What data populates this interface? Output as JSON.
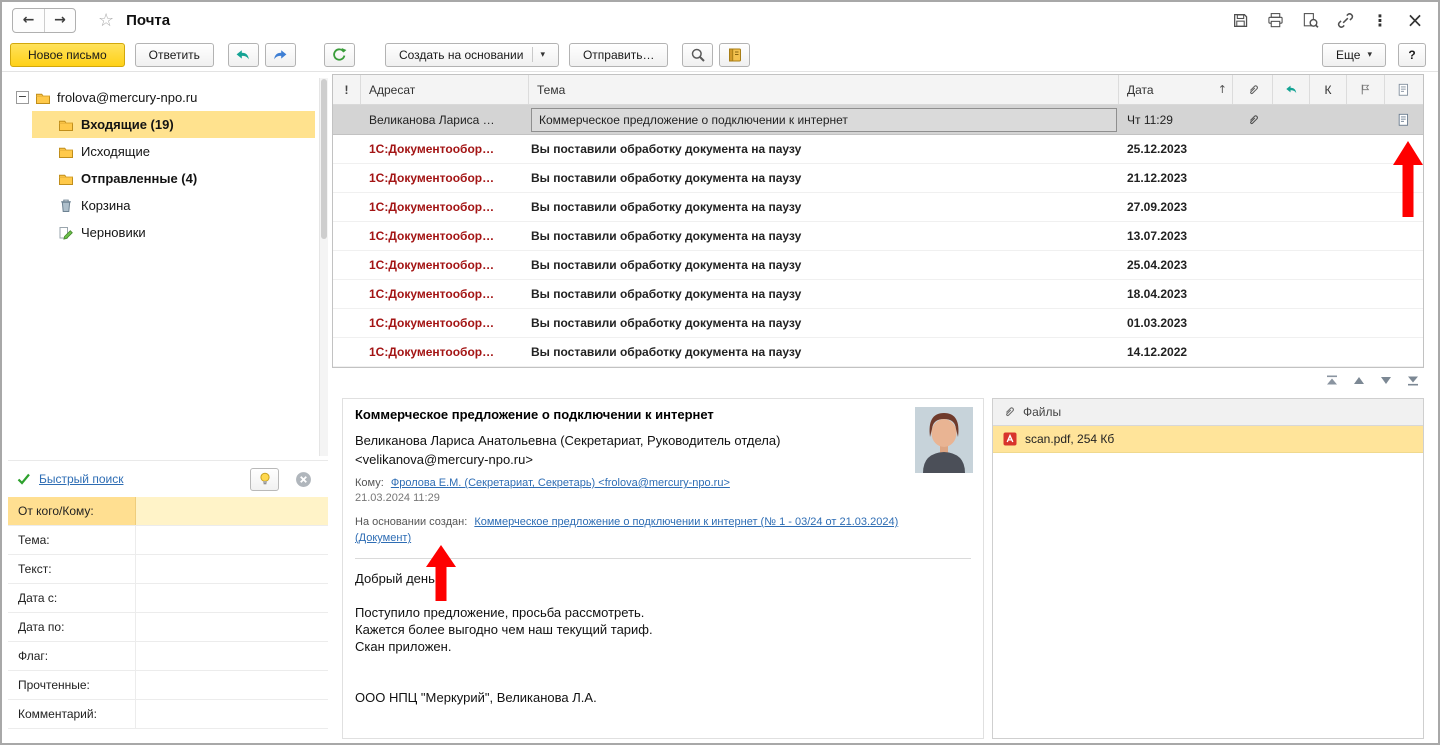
{
  "titlebar": {
    "title": "Почта"
  },
  "icons": {
    "back": "←",
    "forward": "→",
    "star": "☆",
    "kebab": "⋮",
    "close": "×",
    "caret_down": "▾",
    "sort_asc": "↑",
    "collapse": "−"
  },
  "toolbar": {
    "new_letter": "Новое письмо",
    "reply": "Ответить",
    "create_based_on": "Создать на основании",
    "send": "Отправить…",
    "more": "Еще",
    "help": "?"
  },
  "folders": {
    "account": "frolova@mercury-npo.ru",
    "items": [
      {
        "label": "Входящие (19)"
      },
      {
        "label": "Исходящие"
      },
      {
        "label": "Отправленные (4)"
      },
      {
        "label": "Корзина"
      },
      {
        "label": "Черновики"
      }
    ]
  },
  "quick_search": {
    "title": "Быстрый поиск",
    "fields": [
      {
        "label": "От кого/Кому:"
      },
      {
        "label": "Тема:"
      },
      {
        "label": "Текст:"
      },
      {
        "label": "Дата с:"
      },
      {
        "label": "Дата по:"
      },
      {
        "label": "Флаг:"
      },
      {
        "label": "Прочтенные:"
      },
      {
        "label": "Комментарий:"
      }
    ]
  },
  "mail_list": {
    "header": {
      "importance": "!",
      "addressee": "Адресат",
      "subject": "Тема",
      "date": "Дата",
      "k": "К"
    },
    "selected": {
      "addressee": "Великанова Лариса …",
      "subject": "Коммерческое предложение о подключении к интернет",
      "date": "Чт 11:29"
    },
    "rows": [
      {
        "addressee": "1С:Документообор…",
        "subject": "Вы поставили обработку документа на паузу",
        "date": "25.12.2023"
      },
      {
        "addressee": "1С:Документообор…",
        "subject": "Вы поставили обработку документа на паузу",
        "date": "21.12.2023"
      },
      {
        "addressee": "1С:Документообор…",
        "subject": "Вы поставили обработку документа на паузу",
        "date": "27.09.2023"
      },
      {
        "addressee": "1С:Документообор…",
        "subject": "Вы поставили обработку документа на паузу",
        "date": "13.07.2023"
      },
      {
        "addressee": "1С:Документообор…",
        "subject": "Вы поставили обработку документа на паузу",
        "date": "25.04.2023"
      },
      {
        "addressee": "1С:Документообор…",
        "subject": "Вы поставили обработку документа на паузу",
        "date": "18.04.2023"
      },
      {
        "addressee": "1С:Документообор…",
        "subject": "Вы поставили обработку документа на паузу",
        "date": "01.03.2023"
      },
      {
        "addressee": "1С:Документообор…",
        "subject": "Вы поставили обработку документа на паузу",
        "date": "14.12.2022"
      }
    ]
  },
  "preview": {
    "subject": "Коммерческое предложение о подключении к интернет",
    "from_line1": "Великанова Лариса Анатольевна (Секретариат, Руководитель отдела)",
    "from_line2": "<velikanova@mercury-npo.ru>",
    "to_label": "Кому:",
    "to_link": "Фролова Е.М. (Секретариат, Секретарь) <frolova@mercury-npo.ru>",
    "sent_date": "21.03.2024 11:29",
    "based_label": "На основании создан:",
    "based_link": "Коммерческое предложение о подключении к интернет (№ 1 - 03/24 от 21.03.2024) (Документ)",
    "body": [
      "Добрый день !",
      "",
      "Поступило предложение, просьба рассмотреть.",
      "Кажется более выгодно чем наш текущий тариф.",
      "Скан приложен.",
      "",
      "",
      "ООО НПЦ \"Меркурий\", Великанова Л.А."
    ]
  },
  "files": {
    "title": "Файлы",
    "items": [
      {
        "name": "scan.pdf, 254 Кб"
      }
    ]
  },
  "colors": {
    "accent_yellow": "#FFD117",
    "selection_yellow": "#FFE28E",
    "unread_red": "#A31414",
    "link_blue": "#2E6DB4",
    "annotation_red": "#FE0000"
  }
}
